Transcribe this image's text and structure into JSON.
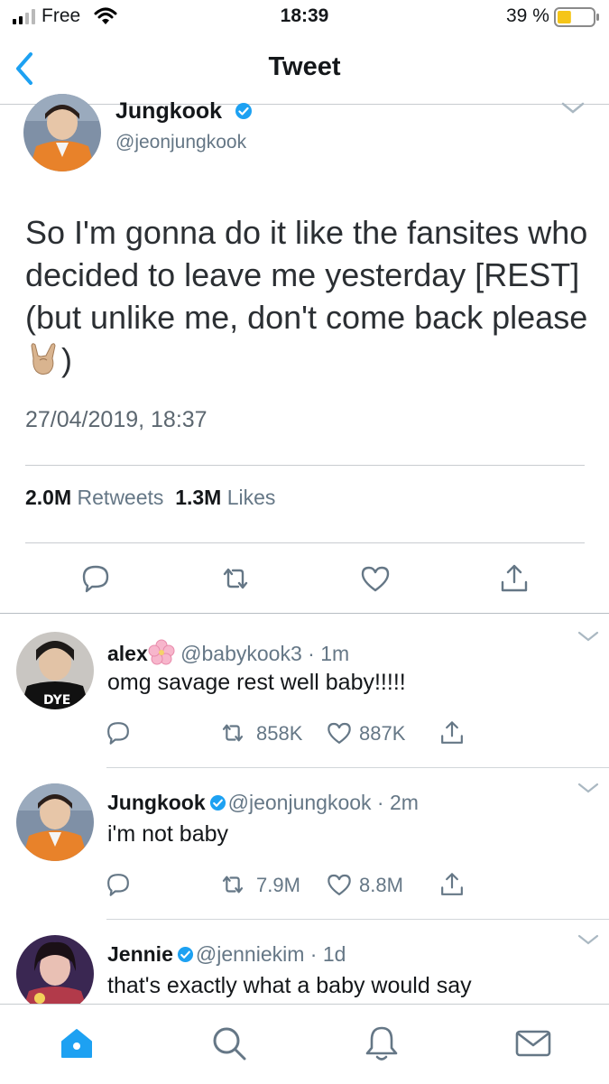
{
  "status_bar": {
    "carrier": "Free",
    "time": "18:39",
    "battery": "39 %",
    "battery_level": 0.39
  },
  "nav": {
    "title": "Tweet",
    "back_icon": "chevron-left-icon"
  },
  "tweet": {
    "name": "Jungkook",
    "handle": "@jeonjungkook",
    "text": "So I'm gonna do it like the fansites who decided to leave me yesterday [REST] (but unlike me, don't come back please",
    "text_end": ")",
    "date": "27/04/2019, 18:37",
    "retweets_count": "2.0M",
    "retweets_label": "Retweets",
    "likes_count": "1.3M",
    "likes_label": "Likes",
    "actions": [
      "reply-icon",
      "retweet-icon",
      "like-icon",
      "share-icon"
    ]
  },
  "replies": [
    {
      "name": "alex",
      "handle": "@babykook3",
      "time": "1m",
      "text": "omg savage rest well baby!!!!!",
      "retweets": "858K",
      "likes": "887K",
      "verified": false
    },
    {
      "name": "Jungkook",
      "handle": "@jeonjungkook",
      "time": "2m",
      "text": "i'm not baby",
      "retweets": "7.9M",
      "likes": "8.8M",
      "verified": true
    },
    {
      "name": "Jennie",
      "handle": "@jenniekim",
      "time": "1d",
      "text": "that's exactly what a baby would say",
      "verified": true
    }
  ],
  "tab_bar": [
    "home-icon",
    "search-icon",
    "notifications-icon",
    "messages-icon"
  ],
  "colors": {
    "accent": "#1da1f2",
    "muted": "#657786",
    "verified": "#1da1f2",
    "battery": "#f5c518"
  }
}
